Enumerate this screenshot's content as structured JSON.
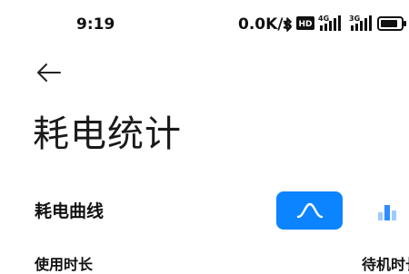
{
  "status_bar": {
    "time": "9:19",
    "net_speed": "0.0K/s",
    "hd_badge": "HD",
    "signal1_label": "4G",
    "signal2_label": "3G",
    "icons": [
      "bluetooth-icon",
      "hd-icon",
      "signal-4g-icon",
      "signal-3g-icon",
      "battery-icon"
    ]
  },
  "header": {
    "back_icon": "back-arrow-icon",
    "title": "耗电统计"
  },
  "section": {
    "title": "耗电曲线",
    "view_toggles": [
      {
        "name": "curve-view",
        "icon": "line-chart-icon",
        "selected": true
      },
      {
        "name": "bar-view",
        "icon": "bar-chart-icon",
        "selected": false
      }
    ],
    "accent_color": "#0d84ff"
  },
  "stats": {
    "usage_label": "使用时长",
    "standby_label": "待机时长"
  }
}
